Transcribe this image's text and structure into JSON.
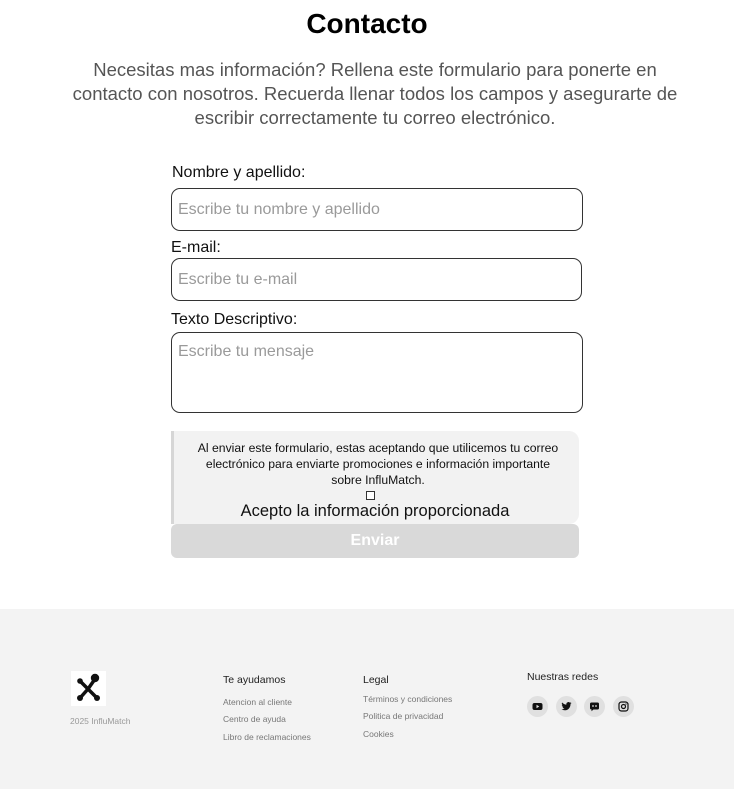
{
  "page": {
    "title": "Contacto",
    "intro": "Necesitas mas información? Rellena este formulario para ponerte en contacto con nosotros. Recuerda llenar todos los campos y asegurarte de escribir correctamente tu correo electrónico."
  },
  "form": {
    "name_label": "Nombre y apellido:",
    "name_placeholder": "Escribe tu nombre y apellido",
    "email_label": "E-mail:",
    "email_placeholder": "Escribe tu e-mail",
    "message_label": "Texto Descriptivo:",
    "message_placeholder": "Escribe tu mensaje",
    "consent_text": "Al enviar este formulario, estas aceptando que utilicemos tu correo electrónico para enviarte promociones e información importante sobre InfluMatch.",
    "consent_checkbox_label": "Acepto la información proporcionada",
    "submit_label": "Enviar"
  },
  "footer": {
    "copyright": "2025 InfluMatch",
    "logo_icon": "network-nodes-icon",
    "help": {
      "title": "Te ayudamos",
      "links": [
        "Atencion al cliente",
        "Centro de ayuda",
        "Libro de reclamaciones"
      ]
    },
    "legal": {
      "title": "Legal",
      "links": [
        "Términos y condiciones",
        "Politica de privacidad",
        "Cookies"
      ]
    },
    "social": {
      "title": "Nuestras redes",
      "icons": [
        "youtube-icon",
        "twitter-icon",
        "discord-icon",
        "instagram-icon"
      ]
    }
  }
}
